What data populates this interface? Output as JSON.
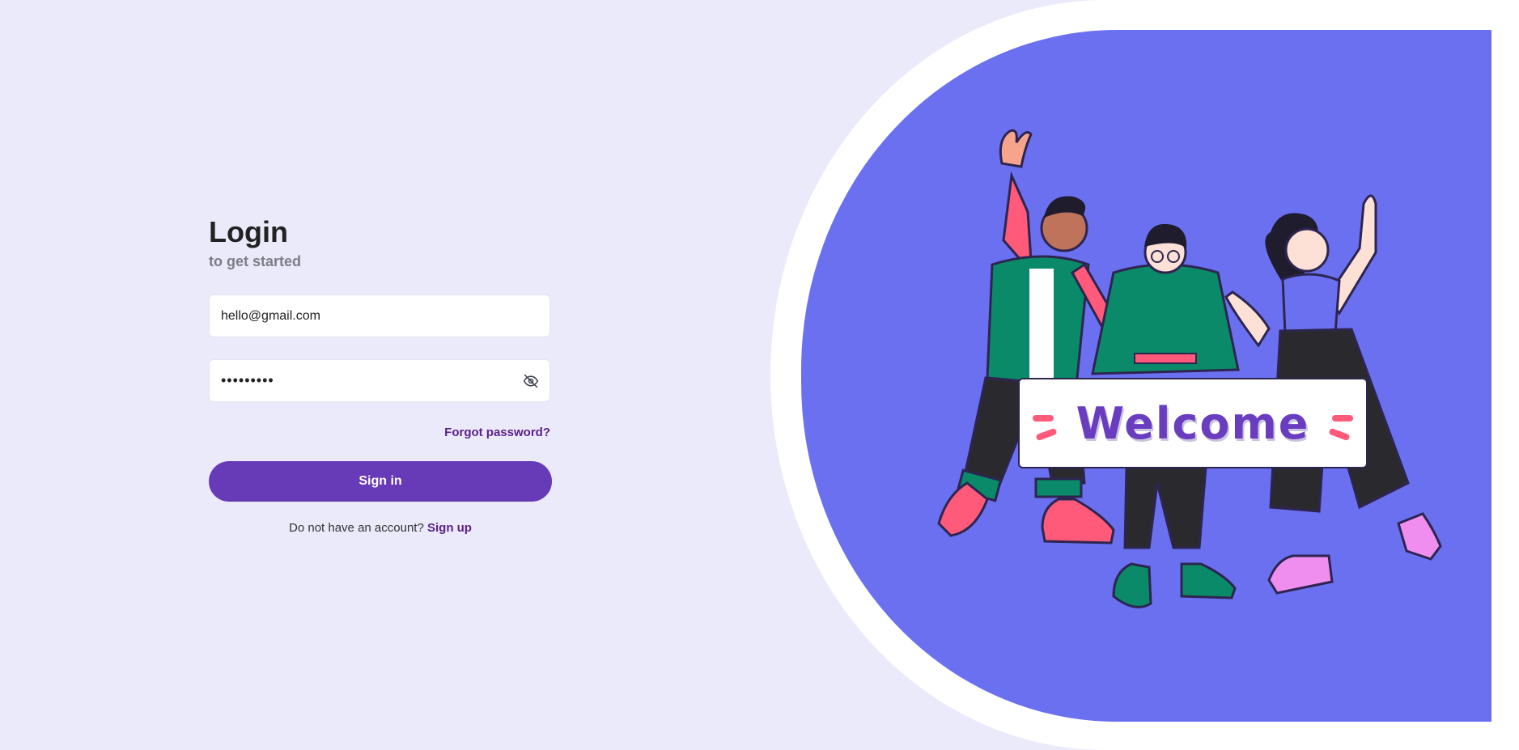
{
  "login": {
    "title": "Login",
    "subtitle": "to get started",
    "email_value": "hello@gmail.com",
    "password_value": "•••••••••",
    "password_toggle_icon": "eye-off-icon",
    "forgot_label": "Forgot password?",
    "signin_label": "Sign in",
    "signup_prompt": "Do not have an account?",
    "signup_label": "Sign up"
  },
  "illustration": {
    "banner_text": "Welcome"
  },
  "colors": {
    "page_bg": "#ebeafb",
    "primary": "#673ab7",
    "link": "#5a1f8a",
    "art_bg": "#6b70f1"
  }
}
